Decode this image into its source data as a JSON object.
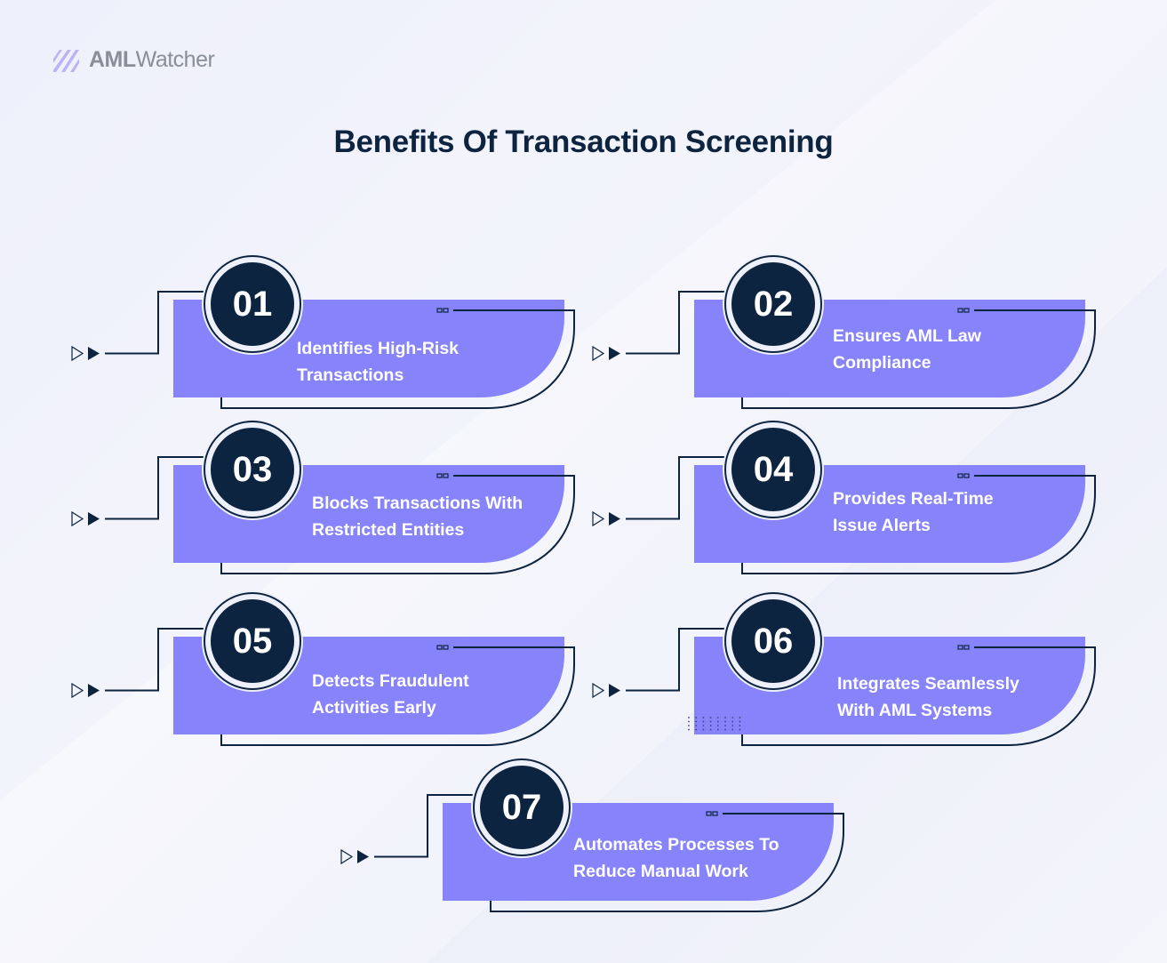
{
  "brand": {
    "logo_bold": "AML",
    "logo_light": "Watcher",
    "icon": "stripes-logo-icon"
  },
  "title": "Benefits Of Transaction Screening",
  "colors": {
    "card_fill": "#8783fa",
    "dark": "#0d2440",
    "text_light": "#ffffff",
    "logo_gray": "#8a8e99",
    "logo_icon": "#b9b3f7"
  },
  "benefits": [
    {
      "number": "01",
      "line1": "Identifies High-Risk",
      "line2": "Transactions"
    },
    {
      "number": "02",
      "line1": "Ensures AML Law",
      "line2": "Compliance"
    },
    {
      "number": "03",
      "line1": "Blocks Transactions With",
      "line2": "Restricted Entities"
    },
    {
      "number": "04",
      "line1": "Provides Real-Time",
      "line2": "Issue Alerts"
    },
    {
      "number": "05",
      "line1": "Detects Fraudulent",
      "line2": "Activities Early"
    },
    {
      "number": "06",
      "line1": "Integrates Seamlessly",
      "line2": "With AML Systems"
    },
    {
      "number": "07",
      "line1": "Automates Processes To",
      "line2": "Reduce Manual Work"
    }
  ]
}
